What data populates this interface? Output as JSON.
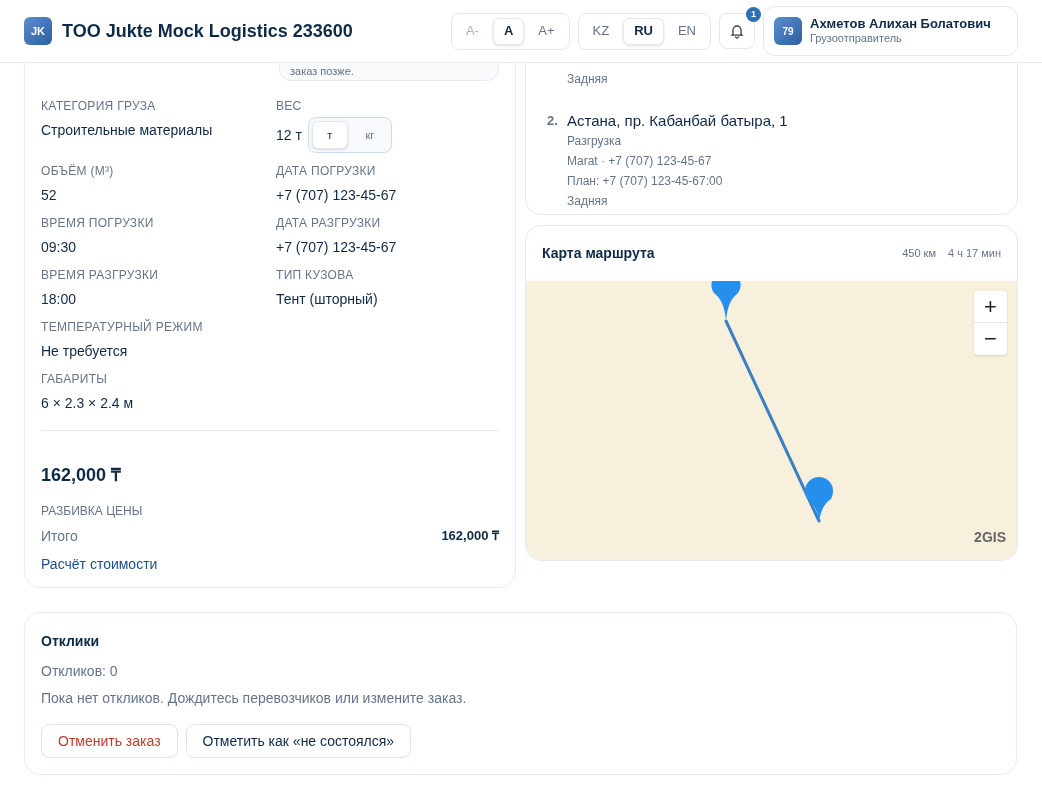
{
  "header": {
    "logo": "JK",
    "company": "TOO Jukte Mock Logistics 233600",
    "font_sizes": [
      {
        "label": "A-",
        "selected": false,
        "disabled": true
      },
      {
        "label": "A",
        "selected": true,
        "disabled": false
      },
      {
        "label": "A+",
        "selected": false,
        "disabled": false
      }
    ],
    "languages": [
      {
        "label": "KZ",
        "selected": false
      },
      {
        "label": "RU",
        "selected": true
      },
      {
        "label": "EN",
        "selected": false
      }
    ],
    "notifications": {
      "count": "1"
    },
    "user": {
      "initials": "79",
      "name": "Ахметов Алихан Болатович",
      "role": "Грузоотправитель"
    }
  },
  "note": {
    "text": "заказ позже."
  },
  "cargo_fields": [
    {
      "kind": "text",
      "label": "КАТЕГОРИЯ ГРУЗА",
      "value": "Строительные материалы"
    },
    {
      "kind": "weight",
      "label": "ВЕС",
      "value": "12 т",
      "units": [
        {
          "label": "т",
          "selected": true
        },
        {
          "label": "кг",
          "selected": false
        }
      ]
    },
    {
      "kind": "text",
      "label": "ОБЪЁМ (М³)",
      "value": "52"
    },
    {
      "kind": "text",
      "label": "ДАТА ПОГРУЗКИ",
      "value": "+7 (707) 123-45-67"
    },
    {
      "kind": "text",
      "label": "ВРЕМЯ ПОГРУЗКИ",
      "value": "09:30"
    },
    {
      "kind": "text",
      "label": "ДАТА РАЗГРУЗКИ",
      "value": "+7 (707) 123-45-67"
    },
    {
      "kind": "text",
      "label": "ВРЕМЯ РАЗГРУЗКИ",
      "value": "18:00"
    },
    {
      "kind": "text",
      "label": "ТИП КУЗОВА",
      "value": "Тент (шторный)"
    }
  ],
  "extra_fields": [
    {
      "label": "ТЕМПЕРАТУРНЫЙ РЕЖИМ",
      "value": "Не требуется"
    },
    {
      "label": "ГАБАРИТЫ",
      "value": "6 × 2.3 × 2.4 м"
    }
  ],
  "price": {
    "total": "162,000 ₸",
    "breakdown_title": "РАЗБИВКА ЦЕНЫ",
    "rows": [
      {
        "label": "Итого",
        "value": "162,000 ₸"
      }
    ],
    "link": "Расчёт стоимости"
  },
  "route_stops": [
    {
      "details": [
        "Задняя"
      ]
    },
    {
      "number": "2.",
      "address": "Астана, пр. Кабанбай батыра, 1",
      "details": [
        "Разгрузка",
        "Marat · +7 (707) 123-45-67",
        "План: +7 (707) 123-45-67:00",
        "Задняя"
      ]
    }
  ],
  "map": {
    "title": "Карта маршрута",
    "distance": "450 км",
    "duration": "4 ч 17 мин",
    "zoom_in": "+",
    "zoom_out": "−",
    "attribution": "2GIS"
  },
  "responses": {
    "title": "Отклики",
    "count": "Откликов: 0",
    "empty": "Пока нет откликов. Дождитесь перевозчиков или измените заказ.",
    "buttons": [
      {
        "label": "Отменить заказ",
        "kind": "danger"
      },
      {
        "label": "Отметить как «не состоялся»",
        "kind": "default"
      }
    ]
  }
}
